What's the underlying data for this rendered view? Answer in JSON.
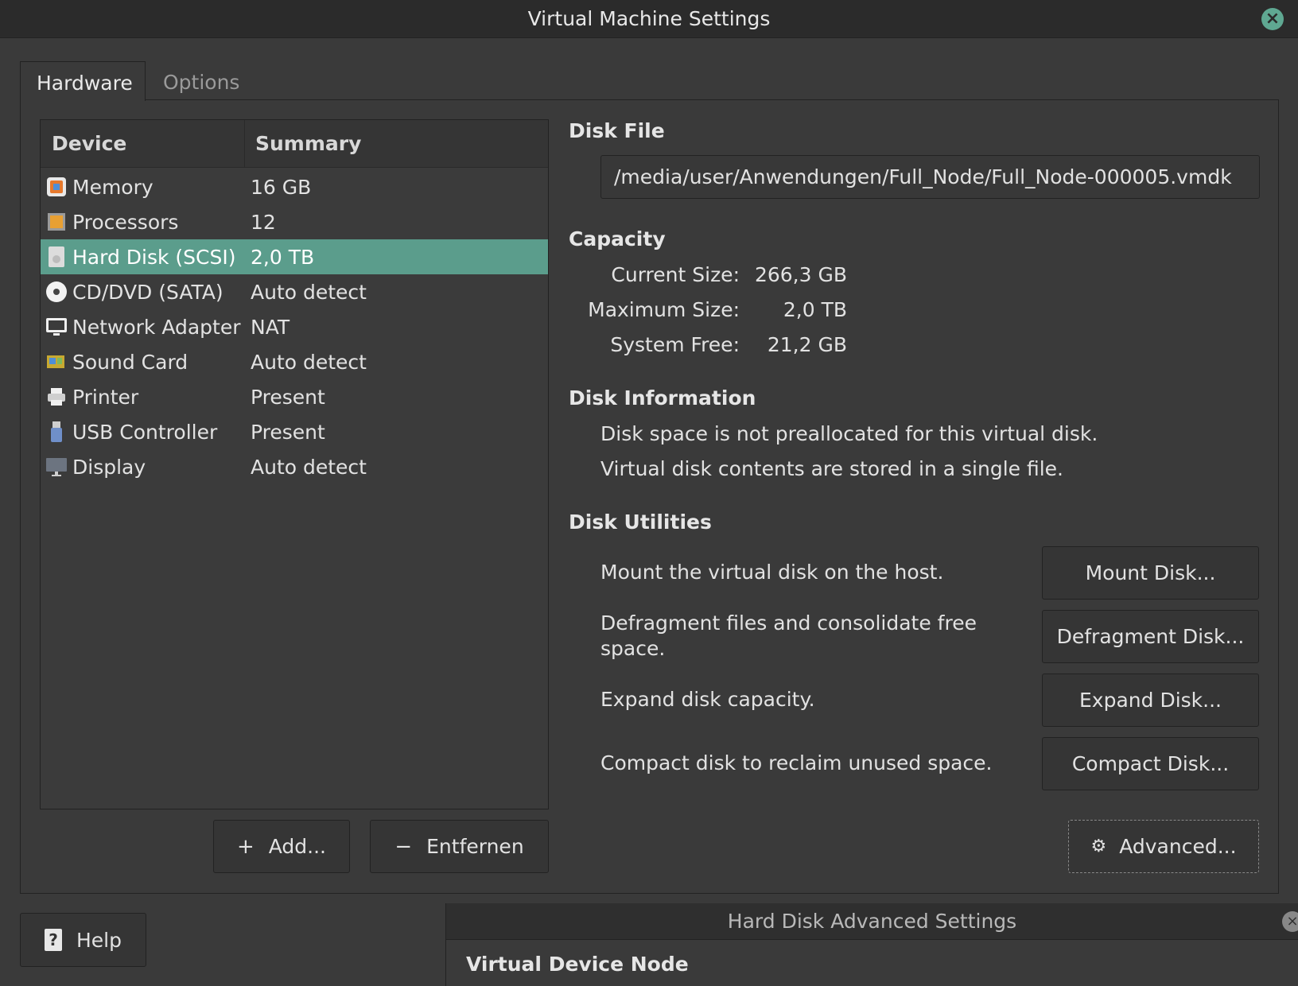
{
  "window": {
    "title": "Virtual Machine Settings"
  },
  "tabs": [
    {
      "label": "Hardware"
    },
    {
      "label": "Options"
    }
  ],
  "devices": {
    "header": {
      "device": "Device",
      "summary": "Summary"
    },
    "rows": [
      {
        "name": "Memory",
        "summary": "16 GB",
        "icon": "memory-icon"
      },
      {
        "name": "Processors",
        "summary": "12",
        "icon": "processor-icon"
      },
      {
        "name": "Hard Disk (SCSI)",
        "summary": "2,0 TB",
        "icon": "hard-disk-icon",
        "selected": true
      },
      {
        "name": "CD/DVD (SATA)",
        "summary": "Auto detect",
        "icon": "cd-dvd-icon"
      },
      {
        "name": "Network Adapter",
        "summary": "NAT",
        "icon": "network-adapter-icon"
      },
      {
        "name": "Sound Card",
        "summary": "Auto detect",
        "icon": "sound-card-icon"
      },
      {
        "name": "Printer",
        "summary": "Present",
        "icon": "printer-icon"
      },
      {
        "name": "USB Controller",
        "summary": "Present",
        "icon": "usb-icon"
      },
      {
        "name": "Display",
        "summary": "Auto detect",
        "icon": "display-icon"
      }
    ],
    "add_label": "Add...",
    "remove_label": "Entfernen"
  },
  "disk_file": {
    "title": "Disk File",
    "path": "/media/user/Anwendungen/Full_Node/Full_Node-000005.vmdk"
  },
  "capacity": {
    "title": "Capacity",
    "current_label": "Current Size:",
    "current_value": "266,3 GB",
    "max_label": "Maximum Size:",
    "max_value": "2,0 TB",
    "free_label": "System Free:",
    "free_value": "21,2 GB"
  },
  "disk_info": {
    "title": "Disk Information",
    "line1": "Disk space is not preallocated for this virtual disk.",
    "line2": "Virtual disk contents are stored in a single file."
  },
  "utilities": {
    "title": "Disk Utilities",
    "mount_text": "Mount the virtual disk on the host.",
    "mount_button": "Mount Disk...",
    "defrag_text": "Defragment files and consolidate free space.",
    "defrag_button": "Defragment Disk...",
    "expand_text": "Expand disk capacity.",
    "expand_button": "Expand Disk...",
    "compact_text": "Compact disk to reclaim unused space.",
    "compact_button": "Compact Disk...",
    "advanced_button": "Advanced..."
  },
  "help": {
    "label": "Help"
  },
  "advanced_dialog": {
    "title": "Hard Disk Advanced Settings",
    "heading": "Virtual Device Node"
  },
  "colors": {
    "selection": "#5b9d8c",
    "background": "#3a3a3a",
    "titlebar": "#2b2b2b"
  }
}
